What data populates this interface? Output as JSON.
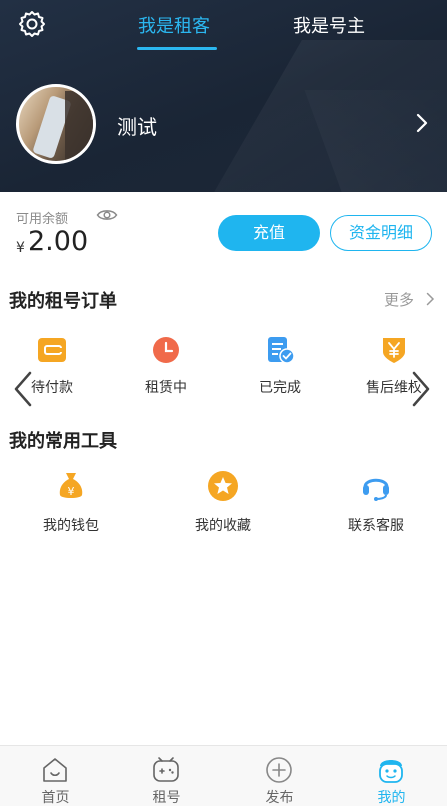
{
  "header": {
    "tabs": [
      {
        "label": "我是租客",
        "active": true
      },
      {
        "label": "我是号主",
        "active": false
      }
    ],
    "username": "测试",
    "accent_color": "#2bb7f0"
  },
  "balance": {
    "label": "可用余额",
    "currency": "¥",
    "amount": "2.00",
    "recharge_label": "充值",
    "detail_label": "资金明细"
  },
  "orders": {
    "title": "我的租号订单",
    "more_label": "更多",
    "items": [
      {
        "label": "待付款",
        "icon": "wallet-icon",
        "color": "#f5a623"
      },
      {
        "label": "租赁中",
        "icon": "clock-icon",
        "color": "#f06a4a"
      },
      {
        "label": "已完成",
        "icon": "completed-doc-icon",
        "color": "#3d9cf0"
      },
      {
        "label": "售后维权",
        "icon": "yen-shield-icon",
        "color": "#f5a623"
      }
    ]
  },
  "tools": {
    "title": "我的常用工具",
    "items": [
      {
        "label": "我的钱包",
        "icon": "money-bag-icon",
        "color": "#f5a623"
      },
      {
        "label": "我的收藏",
        "icon": "star-icon",
        "color": "#f5a623"
      },
      {
        "label": "联系客服",
        "icon": "headset-icon",
        "color": "#3d9cf0"
      }
    ]
  },
  "tabbar": {
    "items": [
      {
        "label": "首页",
        "icon": "home-icon",
        "active": false
      },
      {
        "label": "租号",
        "icon": "gamepad-icon",
        "active": false
      },
      {
        "label": "发布",
        "icon": "plus-circle-icon",
        "active": false
      },
      {
        "label": "我的",
        "icon": "profile-face-icon",
        "active": true
      }
    ],
    "active_color": "#1fb5ef"
  }
}
